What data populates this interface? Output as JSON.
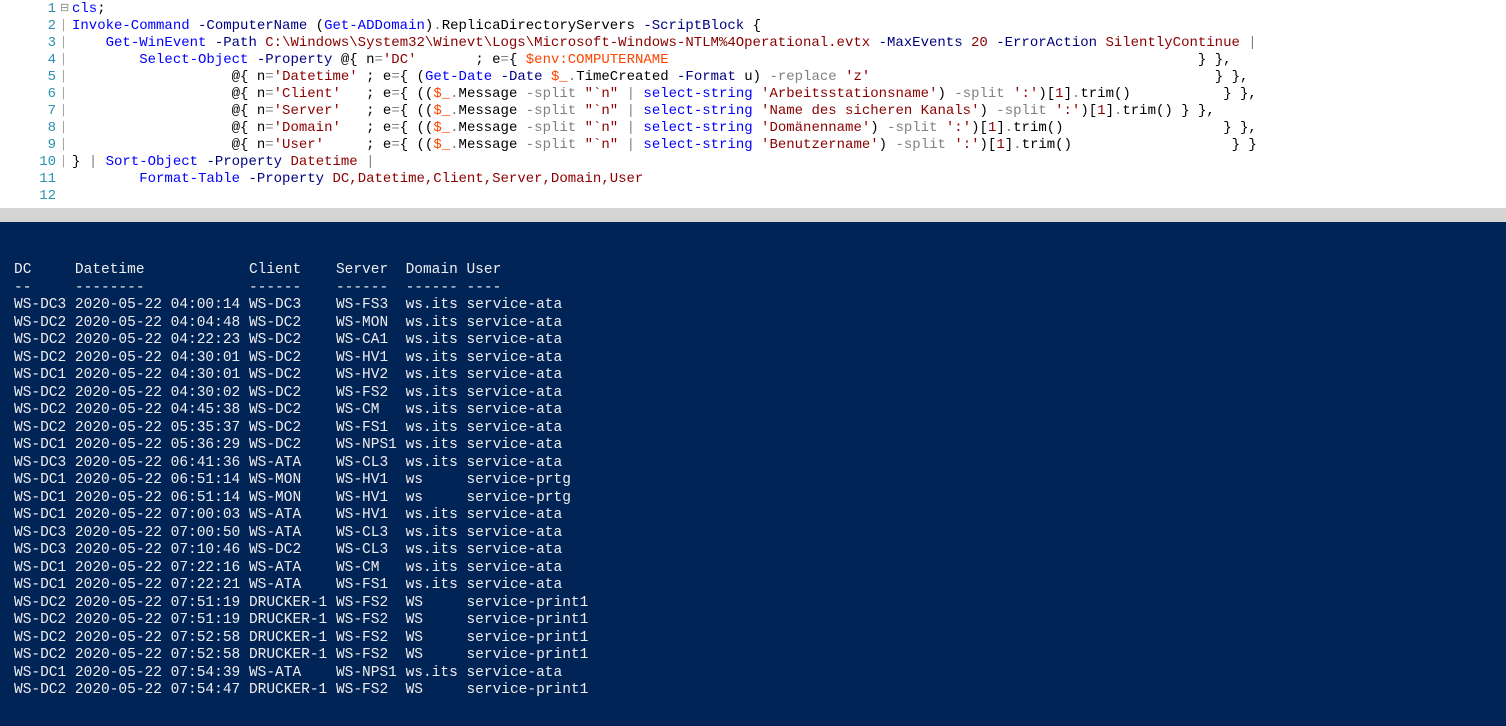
{
  "lineNumbers": [
    "1",
    "2",
    "3",
    "4",
    "5",
    "6",
    "7",
    "8",
    "9",
    "10",
    "11",
    "12"
  ],
  "fold": [
    "",
    "⊟",
    "│",
    "│",
    "│",
    "│",
    "│",
    "│",
    "│",
    "│",
    "│",
    " "
  ],
  "code": {
    "l1": [
      "cls",
      ";"
    ],
    "l2": {
      "cmd": "Invoke-Command",
      "p1": "-ComputerName",
      "g1": "(",
      "cmd2": "Get-ADDomain",
      "g2": ")",
      "m1": ".",
      "prop": "ReplicaDirectoryServers",
      "p2": "-ScriptBlock",
      "g3": "{"
    },
    "l3": {
      "pad": "    ",
      "cmd": "Get-WinEvent",
      "p1": "-Path",
      "path": "C:\\Windows\\System32\\Winevt\\Logs\\Microsoft-Windows-NTLM%4Operational.evtx",
      "p2": "-MaxEvents",
      "n20": "20",
      "p3": "-ErrorAction",
      "v3": "SilentlyContinue",
      "pipe": "|"
    },
    "l4": {
      "pad": "        ",
      "cmd": "Select-Object",
      "p1": "-Property",
      "at": "@{",
      "nk": " n",
      "eq": "=",
      "qDC": "'DC'",
      "sp": "       ",
      "semi": ";",
      "ek": " e",
      "eq2": "=",
      "ob": "{",
      "env": "$env:COMPUTERNAME",
      "cb": "} },",
      "endpad": "                                                               "
    },
    "l5": {
      "pad": "                   ",
      "at": "@{",
      "nk": " n",
      "eq": "=",
      "qDt": "'Datetime'",
      "sp": " ",
      "semi": ";",
      "ek": " e",
      "eq2": "=",
      "ob": "{ (",
      "cmd": "Get-Date",
      "p1": "-Date",
      "var": "$_",
      "dot": ".",
      "prop": "TimeCreated",
      "p2": "-Format",
      "vu": "u",
      "g2": ")",
      "rep": "-replace",
      "qz": "'z'",
      "cb": "} },",
      "endpad": "                                         "
    },
    "l6": {
      "pad": "                   ",
      "at": "@{ n",
      "eq": "=",
      "qClient": "'Client'",
      "sp": "   ",
      "semi": ";",
      "ek": " e",
      "eq2": "=",
      "ob": "{ ((",
      "var": "$_",
      "dot": ".",
      "msg": "Message",
      "split": "-split",
      "qn": "\"`n\"",
      "pipe": "|",
      "ss": "select-string",
      "qArb": "'Arbeitsstationsname'",
      "g2": ")",
      "split2": "-split",
      "qcolon": "':'",
      "g3": ")[",
      "idx": "1",
      "g4": "]",
      "dot2": ".",
      "trim": "trim",
      "g5": "()",
      "cb": "} },",
      "endpad": "           "
    },
    "l7": {
      "pad": "                   ",
      "at": "@{ n",
      "eq": "=",
      "qServer": "'Server'",
      "sp": "   ",
      "semi": ";",
      "ek": " e",
      "eq2": "=",
      "ob": "{ ((",
      "var": "$_",
      "dot": ".",
      "msg": "Message",
      "split": "-split",
      "qn": "\"`n\"",
      "pipe": "|",
      "ss": "select-string",
      "qName": "'Name des sicheren Kanals'",
      "g2": ")",
      "split2": "-split",
      "qcolon": "':'",
      "g3": ")[",
      "idx": "1",
      "g4": "]",
      "dot2": ".",
      "trim": "trim",
      "g5": "()",
      "cb": " } },"
    },
    "l8": {
      "pad": "                   ",
      "at": "@{ n",
      "eq": "=",
      "qDom": "'Domain'",
      "sp": "   ",
      "semi": ";",
      "ek": " e",
      "eq2": "=",
      "ob": "{ ((",
      "var": "$_",
      "dot": ".",
      "msg": "Message",
      "split": "-split",
      "qn": "\"`n\"",
      "pipe": "|",
      "ss": "select-string",
      "qDomN": "'Domänenname'",
      "g2": ")",
      "split2": "-split",
      "qcolon": "':'",
      "g3": ")[",
      "idx": "1",
      "g4": "]",
      "dot2": ".",
      "trim": "trim",
      "g5": "()",
      "cb": "} },",
      "endpad": "                   "
    },
    "l9": {
      "pad": "                   ",
      "at": "@{ n",
      "eq": "=",
      "qUser": "'User'",
      "sp": "     ",
      "semi": ";",
      "ek": " e",
      "eq2": "=",
      "ob": "{ ((",
      "var": "$_",
      "dot": ".",
      "msg": "Message",
      "split": "-split",
      "qn": "\"`n\"",
      "pipe": "|",
      "ss": "select-string",
      "qBen": "'Benutzername'",
      "g2": ")",
      "split2": "-split",
      "qcolon": "':'",
      "g3": ")[",
      "idx": "1",
      "g4": "]",
      "dot2": ".",
      "trim": "trim",
      "g5": "()",
      "cb": "} }",
      "endpad": "                   "
    },
    "l10": {
      "g1": "}",
      "pipe": "|",
      "cmd": "Sort-Object",
      "p1": "-Property",
      "v1": "Datetime",
      "g2": "|"
    },
    "l11": {
      "pad": "        ",
      "cmd": "Format-Table",
      "p1": "-Property",
      "v1": "DC,Datetime,Client,Server,Domain,User"
    }
  },
  "terminal": {
    "headers": [
      "DC    ",
      "Datetime           ",
      "Client   ",
      "Server ",
      "Domain",
      "User"
    ],
    "dashes": [
      "--    ",
      "--------           ",
      "------   ",
      "------ ",
      "------",
      "----"
    ],
    "rows": [
      [
        "WS-DC3",
        "2020-05-22 04:00:14",
        "WS-DC3   ",
        "WS-FS3 ",
        "ws.its",
        "service-ata"
      ],
      [
        "WS-DC2",
        "2020-05-22 04:04:48",
        "WS-DC2   ",
        "WS-MON ",
        "ws.its",
        "service-ata"
      ],
      [
        "WS-DC2",
        "2020-05-22 04:22:23",
        "WS-DC2   ",
        "WS-CA1 ",
        "ws.its",
        "service-ata"
      ],
      [
        "WS-DC2",
        "2020-05-22 04:30:01",
        "WS-DC2   ",
        "WS-HV1 ",
        "ws.its",
        "service-ata"
      ],
      [
        "WS-DC1",
        "2020-05-22 04:30:01",
        "WS-DC2   ",
        "WS-HV2 ",
        "ws.its",
        "service-ata"
      ],
      [
        "WS-DC2",
        "2020-05-22 04:30:02",
        "WS-DC2   ",
        "WS-FS2 ",
        "ws.its",
        "service-ata"
      ],
      [
        "WS-DC2",
        "2020-05-22 04:45:38",
        "WS-DC2   ",
        "WS-CM  ",
        "ws.its",
        "service-ata"
      ],
      [
        "WS-DC2",
        "2020-05-22 05:35:37",
        "WS-DC2   ",
        "WS-FS1 ",
        "ws.its",
        "service-ata"
      ],
      [
        "WS-DC1",
        "2020-05-22 05:36:29",
        "WS-DC2   ",
        "WS-NPS1",
        "ws.its",
        "service-ata"
      ],
      [
        "WS-DC3",
        "2020-05-22 06:41:36",
        "WS-ATA   ",
        "WS-CL3 ",
        "ws.its",
        "service-ata"
      ],
      [
        "WS-DC1",
        "2020-05-22 06:51:14",
        "WS-MON   ",
        "WS-HV1 ",
        "ws    ",
        "service-prtg"
      ],
      [
        "WS-DC1",
        "2020-05-22 06:51:14",
        "WS-MON   ",
        "WS-HV1 ",
        "ws    ",
        "service-prtg"
      ],
      [
        "WS-DC1",
        "2020-05-22 07:00:03",
        "WS-ATA   ",
        "WS-HV1 ",
        "ws.its",
        "service-ata"
      ],
      [
        "WS-DC3",
        "2020-05-22 07:00:50",
        "WS-ATA   ",
        "WS-CL3 ",
        "ws.its",
        "service-ata"
      ],
      [
        "WS-DC3",
        "2020-05-22 07:10:46",
        "WS-DC2   ",
        "WS-CL3 ",
        "ws.its",
        "service-ata"
      ],
      [
        "WS-DC1",
        "2020-05-22 07:22:16",
        "WS-ATA   ",
        "WS-CM  ",
        "ws.its",
        "service-ata"
      ],
      [
        "WS-DC1",
        "2020-05-22 07:22:21",
        "WS-ATA   ",
        "WS-FS1 ",
        "ws.its",
        "service-ata"
      ],
      [
        "WS-DC2",
        "2020-05-22 07:51:19",
        "DRUCKER-1",
        "WS-FS2 ",
        "WS    ",
        "service-print1"
      ],
      [
        "WS-DC2",
        "2020-05-22 07:51:19",
        "DRUCKER-1",
        "WS-FS2 ",
        "WS    ",
        "service-print1"
      ],
      [
        "WS-DC2",
        "2020-05-22 07:52:58",
        "DRUCKER-1",
        "WS-FS2 ",
        "WS    ",
        "service-print1"
      ],
      [
        "WS-DC2",
        "2020-05-22 07:52:58",
        "DRUCKER-1",
        "WS-FS2 ",
        "WS    ",
        "service-print1"
      ],
      [
        "WS-DC1",
        "2020-05-22 07:54:39",
        "WS-ATA   ",
        "WS-NPS1",
        "ws.its",
        "service-ata"
      ],
      [
        "WS-DC2",
        "2020-05-22 07:54:47",
        "DRUCKER-1",
        "WS-FS2 ",
        "WS    ",
        "service-print1"
      ]
    ]
  }
}
